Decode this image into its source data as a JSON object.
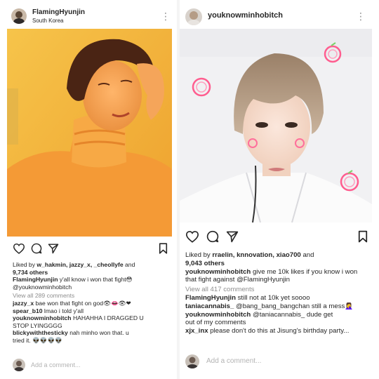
{
  "left": {
    "username": "FlamingHyunjin",
    "location": "South Korea",
    "more_icon": "⋮",
    "likes": {
      "prefix": "Liked by",
      "users": "w_hakmin, jazzy_x, _cheollyfe",
      "and": "and",
      "others": "9,734 others"
    },
    "caption": {
      "user": "FlamingHyunjin",
      "text1": "y'all know i won that fight",
      "text2": "@youknowminhobitch",
      "emoji": "😳"
    },
    "view_comments": "View all 289 comments",
    "comments": [
      {
        "user": "jazzy_x",
        "text": "bae won that fight on god",
        "emoji": "👁👄👁❤"
      },
      {
        "user": "spear_b10",
        "text": "lmao i told y'all"
      },
      {
        "user": "youknowminhobitch",
        "text": "HAHAHHA I DRAGGED U",
        "text2": "STOP LYINGGGG"
      },
      {
        "user": "blickywiththesticky",
        "text": "nah minho won that. u",
        "text2": "tried it.",
        "emoji": "👽👽👽👽"
      }
    ],
    "add_comment": "Add a comment..."
  },
  "right": {
    "username": "youknowminhobitch",
    "more_icon": "⋮",
    "likes": {
      "prefix": "Liked by",
      "users": "rraelin, knnovation, xiao700",
      "and": "and",
      "others": "9,043 others"
    },
    "caption": {
      "user": "youknowminhobitch",
      "text1": "give me 10k likes if you know i won",
      "text2": "that fight against @FlamingHyunjin"
    },
    "view_comments": "View all 417 comments",
    "comments": [
      {
        "user": "FlamingHyunjin",
        "text": "still not at 10k yet soooo"
      },
      {
        "user": "taniacannabis_",
        "text": "@bang_bang_bangchan still a mess",
        "emoji": "🤦‍♀️"
      },
      {
        "user": "youknowminhobitch",
        "text": "@taniacannabis_ dude get",
        "text2": "out of my comments"
      },
      {
        "user": "xjx_inx",
        "text": "please don't do this at Jisung's birthday party..."
      }
    ],
    "add_comment": "Add a comment..."
  },
  "icons": [
    "heart-icon",
    "comment-icon",
    "share-icon",
    "bookmark-icon",
    "more-icon"
  ],
  "colors": {
    "text": "#262626",
    "muted": "#8e8e8e",
    "left_photo_bg": "#f2b233",
    "left_sweater": "#f5a23a",
    "right_photo_bg": "#f3f3f3",
    "neon_pink": "#ff5d8f"
  }
}
